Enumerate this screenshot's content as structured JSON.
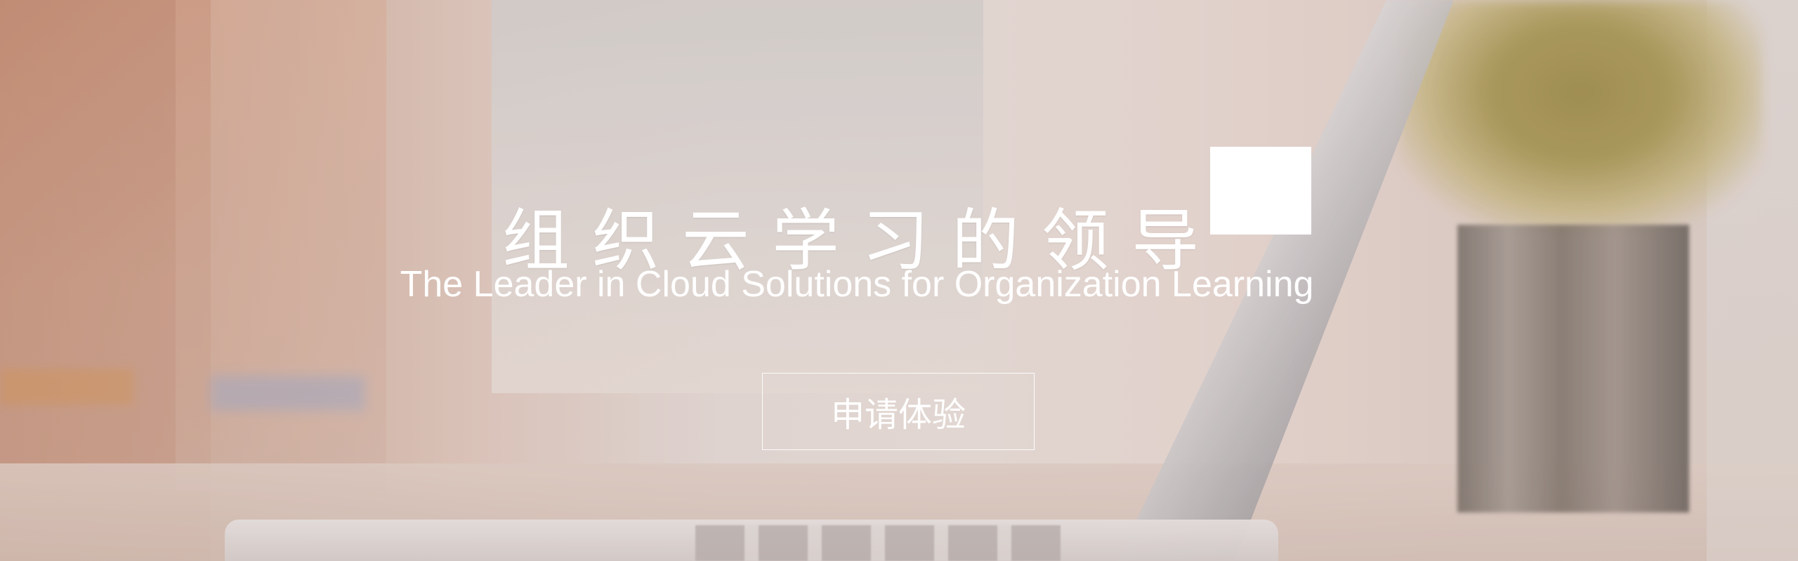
{
  "hero": {
    "headline": "组织云学习的领导",
    "subtitle": "The Leader in Cloud Solutions for Organization Learning",
    "cta_label": "申请体验"
  },
  "colors": {
    "text": "#ffffff",
    "button_border": "#ffffff"
  }
}
